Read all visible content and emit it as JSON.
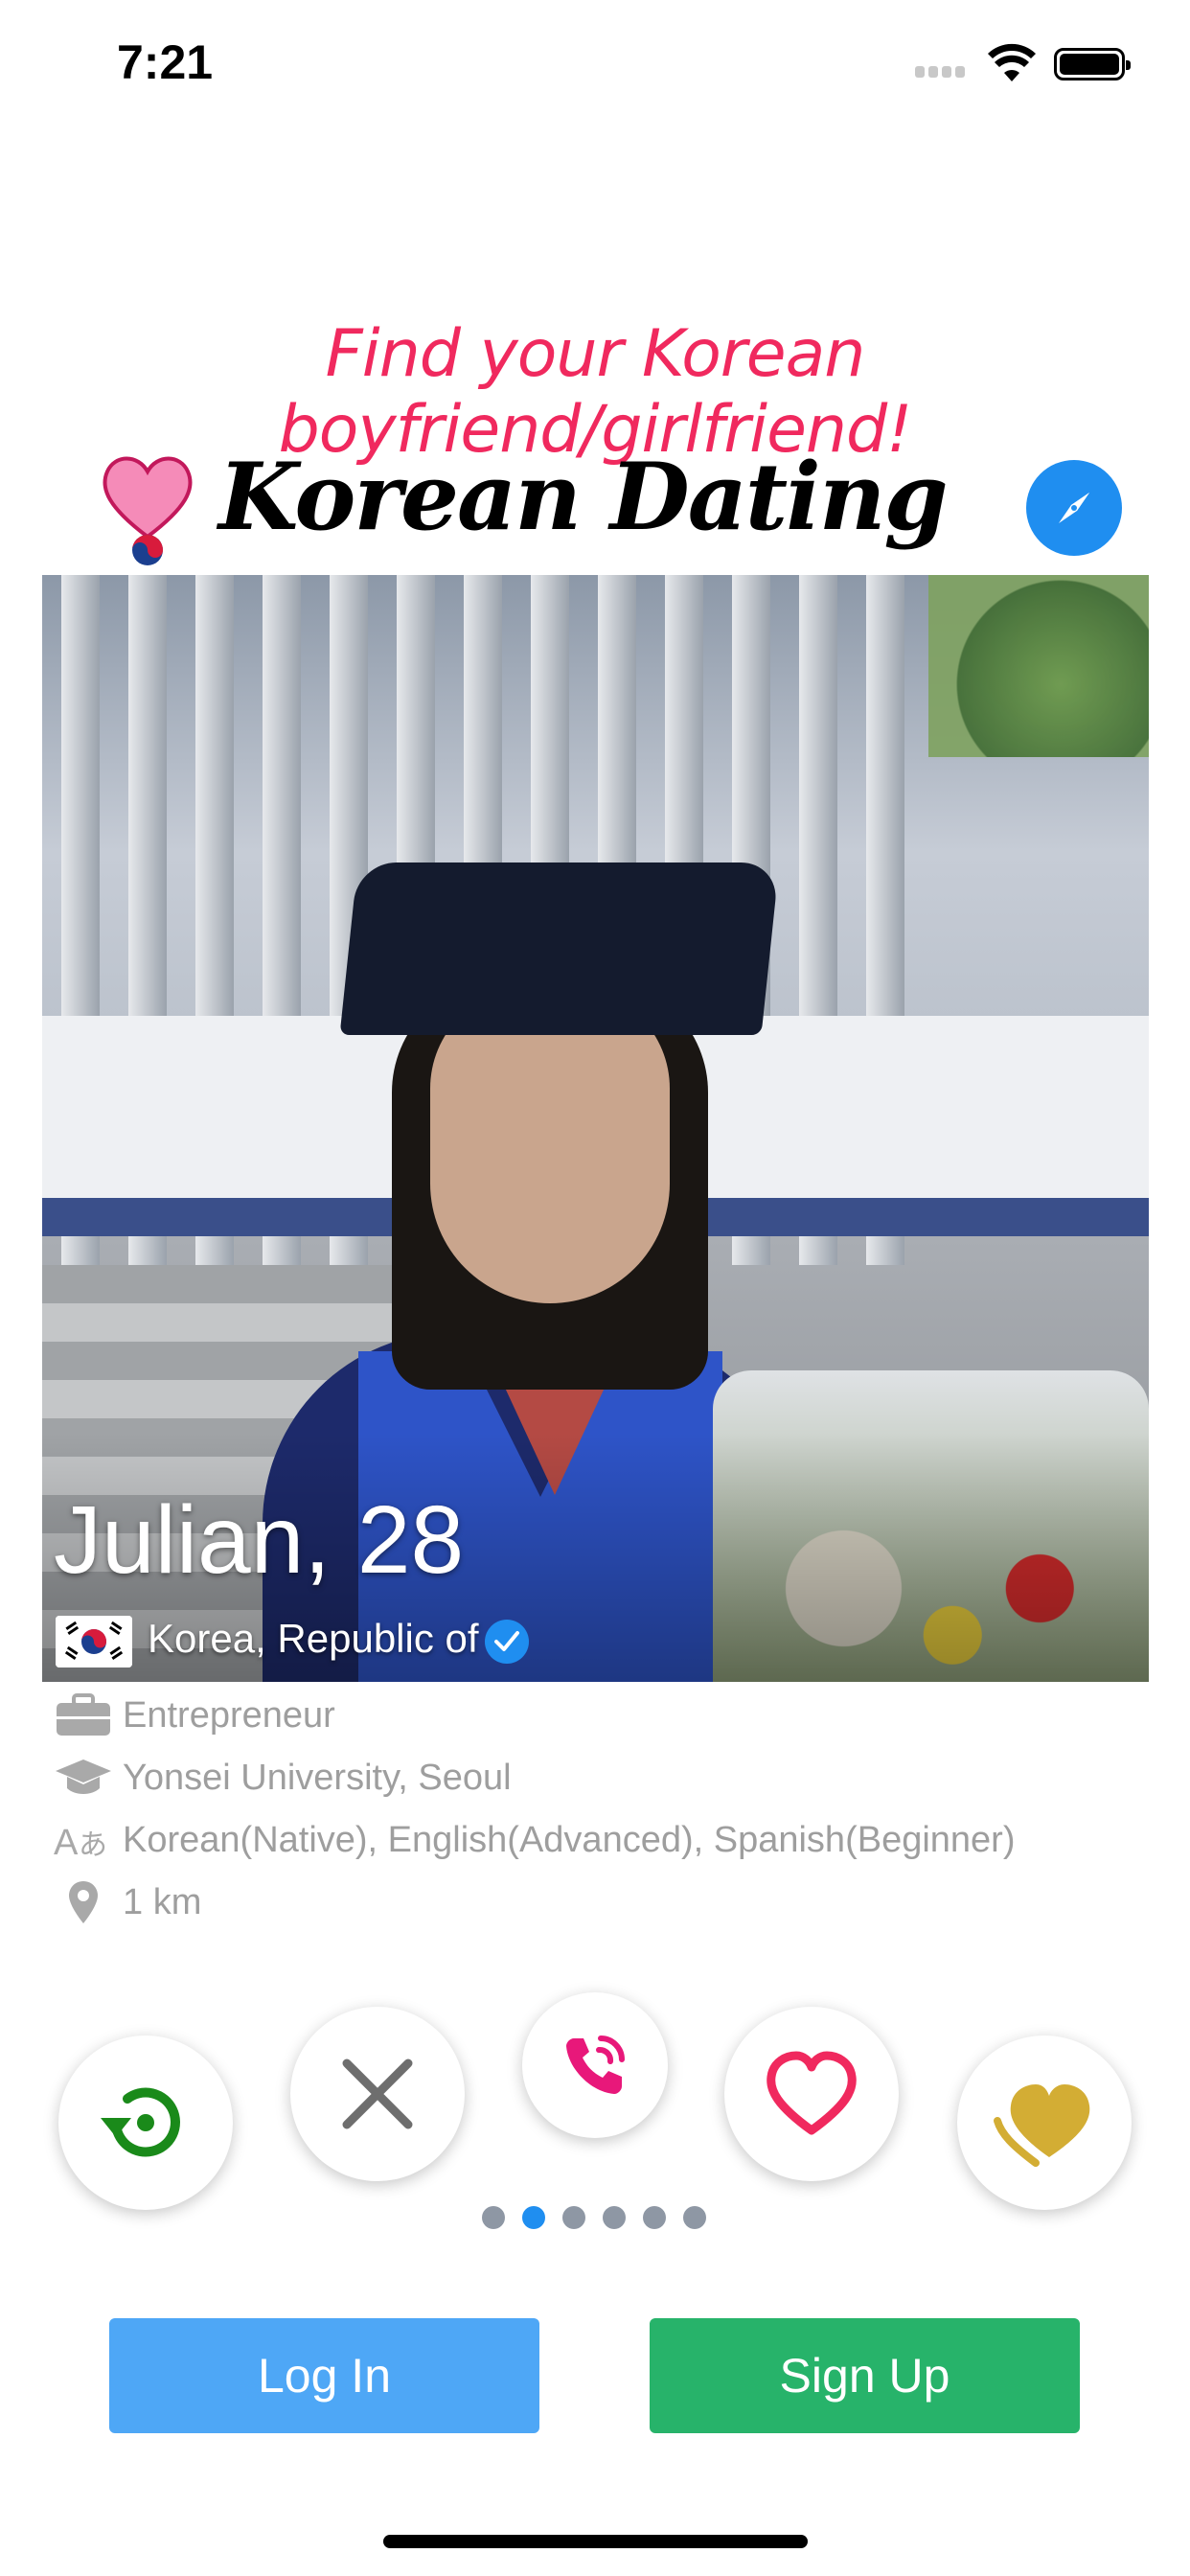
{
  "status_bar": {
    "time": "7:21"
  },
  "tagline": "Find your Korean boyfriend/girlfriend!",
  "header": {
    "brand": "Korean Dating",
    "logo_icon": "heart-pin-icon",
    "compass_icon": "compass-icon"
  },
  "profile": {
    "name_age": "Julian, 28",
    "country": "Korea, Republic of",
    "verified": true,
    "occupation": "Entrepreneur",
    "education": "Yonsei University, Seoul",
    "languages": "Korean(Native), English(Advanced), Spanish(Beginner)",
    "distance": "1 km"
  },
  "actions": [
    {
      "name": "rewind-icon",
      "color": "#1a8a1a"
    },
    {
      "name": "close-icon",
      "color": "#6e6e6e"
    },
    {
      "name": "phone-call-icon",
      "color": "#e8187a"
    },
    {
      "name": "heart-icon",
      "color": "#f0295e"
    },
    {
      "name": "super-like-heart-icon",
      "color": "#d3ad34"
    }
  ],
  "pagination": {
    "count": 6,
    "active_index": 1
  },
  "buttons": {
    "login": "Log In",
    "signup": "Sign Up"
  },
  "colors": {
    "accent_blue": "#1f8ef0",
    "login": "#4ea7f6",
    "signup": "#27b36a",
    "tagline": "#f0295e"
  }
}
